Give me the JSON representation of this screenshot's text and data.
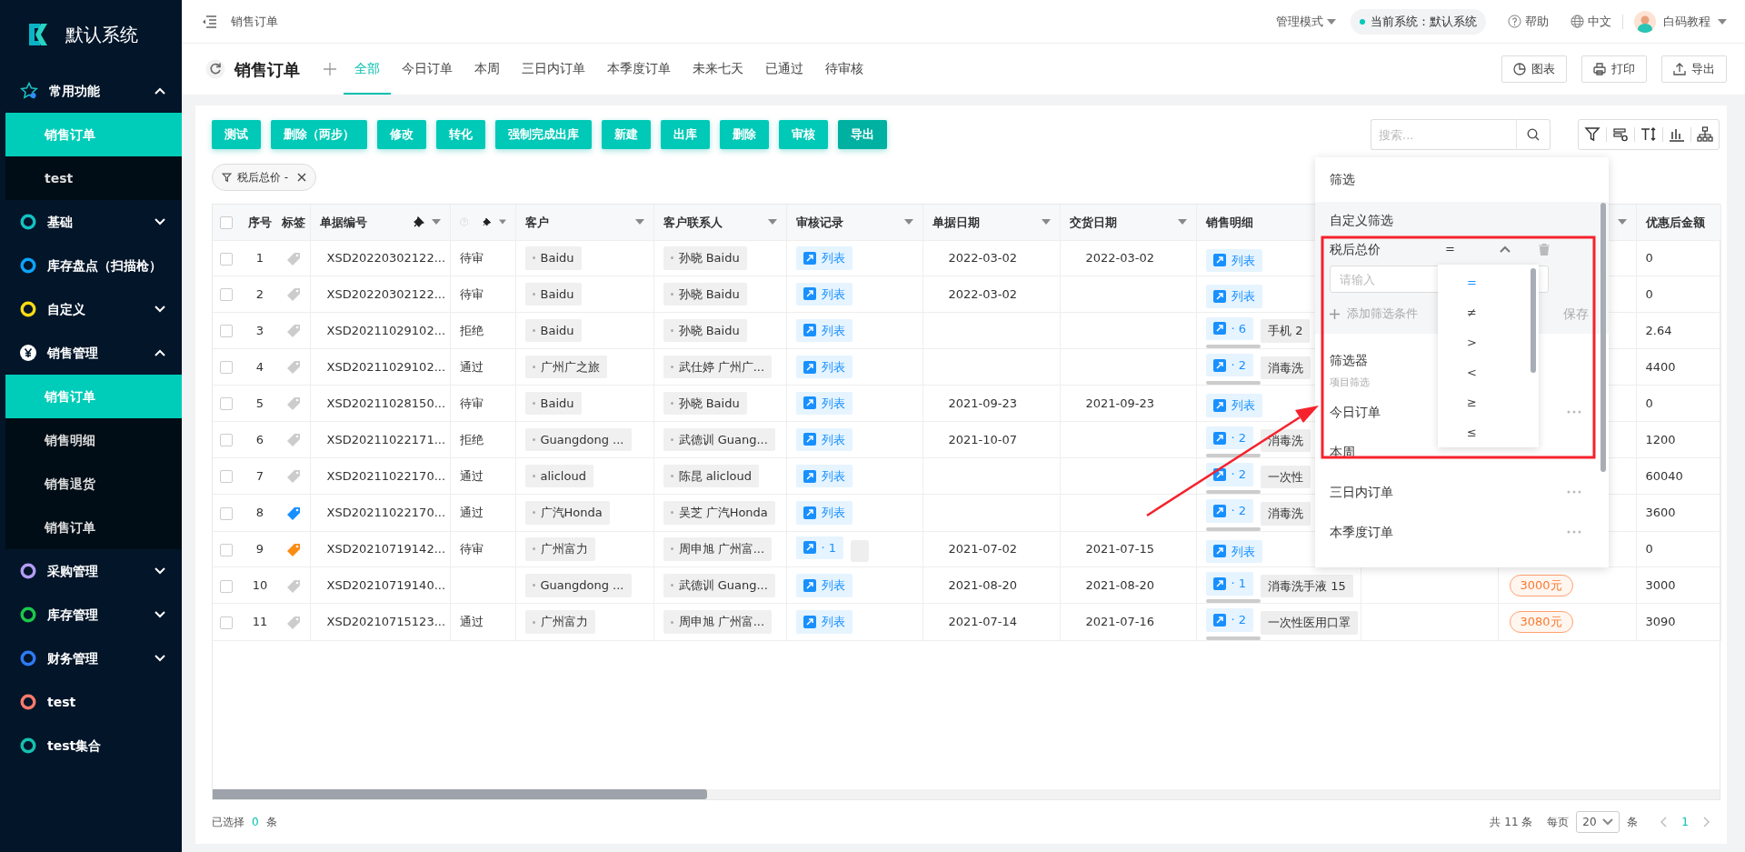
{
  "brand": {
    "name": "默认系统"
  },
  "sidebar": {
    "items": [
      {
        "label": "常用功能",
        "kind": "star",
        "expanded": true,
        "children": [
          {
            "label": "销售订单",
            "selected": true
          },
          {
            "label": "test",
            "selected": false
          }
        ]
      },
      {
        "label": "基础",
        "kind": "ring",
        "color": "#13c2c2",
        "expanded": false
      },
      {
        "label": "库存盘点（扫描枪）",
        "kind": "ring",
        "color": "#0aa5ff"
      },
      {
        "label": "自定义",
        "kind": "ring",
        "color": "#fadb14",
        "expanded": false
      },
      {
        "label": "销售管理",
        "kind": "yen",
        "expanded": true,
        "children": [
          {
            "label": "销售订单",
            "selected": true
          },
          {
            "label": "销售明细",
            "selected": false
          },
          {
            "label": "销售退货",
            "selected": false
          },
          {
            "label": "销售订单",
            "selected": false
          }
        ]
      },
      {
        "label": "采购管理",
        "kind": "ring",
        "color": "#b39cf5",
        "expanded": false
      },
      {
        "label": "库存管理",
        "kind": "ring",
        "color": "#1bc94a",
        "expanded": false
      },
      {
        "label": "财务管理",
        "kind": "ring",
        "color": "#2f7bf5",
        "expanded": false
      },
      {
        "label": "test",
        "kind": "ring",
        "color": "#ff7a6b"
      },
      {
        "label": "test集合",
        "kind": "ring",
        "color": "#13c2b0"
      }
    ]
  },
  "header": {
    "breadcrumb": "销售订单",
    "mode": "管理模式",
    "system": "当前系统：默认系统",
    "help": "帮助",
    "language": "中文",
    "user": "白码教程"
  },
  "page": {
    "title": "销售订单",
    "tabs": [
      {
        "label": "全部",
        "selected": true
      },
      {
        "label": "今日订单",
        "selected": false
      },
      {
        "label": "本周",
        "selected": false
      },
      {
        "label": "三日内订单",
        "selected": false
      },
      {
        "label": "本季度订单",
        "selected": false
      },
      {
        "label": "未来七天",
        "selected": false
      },
      {
        "label": "已通过",
        "selected": false
      },
      {
        "label": "待审核",
        "selected": false
      }
    ],
    "actions": [
      {
        "label": "图表",
        "kind": "chart"
      },
      {
        "label": "打印",
        "kind": "print"
      },
      {
        "label": "导出",
        "kind": "export"
      }
    ]
  },
  "toolbar": {
    "buttons": [
      {
        "label": "测试",
        "active": false
      },
      {
        "label": "删除（两步）",
        "active": false
      },
      {
        "label": "修改",
        "active": false
      },
      {
        "label": "转化",
        "active": false
      },
      {
        "label": "强制完成出库",
        "active": false
      },
      {
        "label": "新建",
        "active": false
      },
      {
        "label": "出库",
        "active": false
      },
      {
        "label": "删除",
        "active": false
      },
      {
        "label": "审核",
        "active": false
      },
      {
        "label": "导出",
        "active": true
      }
    ],
    "search": {
      "placeholder": "搜索..."
    },
    "filter_tags": [
      {
        "label": "税后总价 -"
      }
    ]
  },
  "table": {
    "select_all": {
      "selected": false
    },
    "columns": [
      {
        "label": "序号",
        "kind": "index"
      },
      {
        "label": "标签",
        "kind": "tag"
      },
      {
        "label": "单据编号",
        "kind": "code",
        "pinned": true,
        "sortable": true
      },
      {
        "kind": "status",
        "help": true,
        "pinned": true,
        "sortable": true
      },
      {
        "label": "客户",
        "kind": "customer",
        "sortable": true
      },
      {
        "label": "客户联系人",
        "kind": "contact",
        "sortable": true
      },
      {
        "label": "审核记录",
        "kind": "audit",
        "sortable": true
      },
      {
        "label": "单据日期",
        "kind": "order_date",
        "sortable": true
      },
      {
        "label": "交货日期",
        "kind": "delivery_date",
        "sortable": true
      },
      {
        "label": "销售明细",
        "kind": "detail"
      },
      {
        "kind": "badge",
        "sortable": true
      },
      {
        "label": "优惠后金额",
        "kind": "discounted"
      }
    ],
    "rows": [
      {
        "selected": false,
        "index": "1",
        "color": "#cccccc",
        "code": "XSD20220302122...",
        "status": "待审",
        "customer": "Baidu",
        "contact": "孙晓 Baidu",
        "audit": {
          "kind": "list",
          "label": "列表"
        },
        "order_date": "2022-03-02",
        "delivery_date": "2022-03-02",
        "detail": {
          "kind": "list",
          "label": "列表"
        },
        "discounted": "0"
      },
      {
        "selected": false,
        "index": "2",
        "color": "#cccccc",
        "code": "XSD20220302122...",
        "status": "待审",
        "customer": "Baidu",
        "contact": "孙晓 Baidu",
        "audit": {
          "kind": "list",
          "label": "列表"
        },
        "order_date": "2022-03-02",
        "detail": {
          "kind": "list",
          "label": "列表"
        },
        "discounted": "0"
      },
      {
        "selected": false,
        "index": "3",
        "color": "#cccccc",
        "code": "XSD20211029102...",
        "status": "拒绝",
        "customer": "Baidu",
        "contact": "孙晓 Baidu",
        "audit": {
          "kind": "list",
          "label": "列表"
        },
        "detail": {
          "kind": "count",
          "label": "· 6",
          "item": "手机 2"
        },
        "discounted": "2.64"
      },
      {
        "selected": false,
        "index": "4",
        "color": "#cccccc",
        "code": "XSD20211029102...",
        "status": "通过",
        "customer": "广州广之旅",
        "contact": "武仕婷 广州广...",
        "audit": {
          "kind": "list",
          "label": "列表"
        },
        "detail": {
          "kind": "count",
          "label": "· 2",
          "item": "消毒洗"
        },
        "discounted": "4400"
      },
      {
        "selected": false,
        "index": "5",
        "color": "#cccccc",
        "code": "XSD20211028150...",
        "status": "待审",
        "customer": "Baidu",
        "contact": "孙晓 Baidu",
        "audit": {
          "kind": "list",
          "label": "列表"
        },
        "order_date": "2021-09-23",
        "delivery_date": "2021-09-23",
        "detail": {
          "kind": "list",
          "label": "列表"
        },
        "discounted": "0"
      },
      {
        "selected": false,
        "index": "6",
        "color": "#cccccc",
        "code": "XSD20211022171...",
        "status": "拒绝",
        "customer": "Guangdong ...",
        "contact": "武德训 Guang...",
        "audit": {
          "kind": "list",
          "label": "列表"
        },
        "order_date": "2021-10-07",
        "detail": {
          "kind": "count",
          "label": "· 2",
          "item": "消毒洗"
        },
        "discounted": "1200"
      },
      {
        "selected": false,
        "index": "7",
        "color": "#cccccc",
        "code": "XSD20211022170...",
        "status": "通过",
        "customer": "alicloud",
        "contact": "陈昆 alicloud",
        "audit": {
          "kind": "list",
          "label": "列表"
        },
        "detail": {
          "kind": "count",
          "label": "· 2",
          "item": "一次性"
        },
        "discounted": "60040"
      },
      {
        "selected": false,
        "index": "8",
        "color": "#1890ff",
        "code": "XSD20211022170...",
        "status": "通过",
        "customer": "广汽Honda",
        "contact": "吴芝 广汽Honda",
        "audit": {
          "kind": "list",
          "label": "列表"
        },
        "detail": {
          "kind": "count",
          "label": "· 2",
          "item": "消毒洗"
        },
        "discounted": "3600"
      },
      {
        "selected": false,
        "index": "9",
        "color": "#fa8c16",
        "code": "XSD20210719142...",
        "status": "待审",
        "customer": "广州富力",
        "contact": "周申旭 广州富...",
        "audit": {
          "kind": "count",
          "label": "· 1"
        },
        "order_date": "2021-07-02",
        "delivery_date": "2021-07-15",
        "detail": {
          "kind": "list",
          "label": "列表"
        },
        "discounted": "0"
      },
      {
        "selected": false,
        "index": "10",
        "color": "#cccccc",
        "code": "XSD20210719140...",
        "customer": "Guangdong ...",
        "contact": "武德训 Guang...",
        "audit": {
          "kind": "list",
          "label": "列表"
        },
        "order_date": "2021-08-20",
        "delivery_date": "2021-08-20",
        "detail": {
          "kind": "count",
          "label": "· 1",
          "item": "消毒洗手液 15"
        },
        "badge": "3000元",
        "discounted": "3000"
      },
      {
        "selected": false,
        "index": "11",
        "color": "#cccccc",
        "code": "XSD20210715123...",
        "status": "通过",
        "customer": "广州富力",
        "contact": "周申旭 广州富...",
        "audit": {
          "kind": "list",
          "label": "列表"
        },
        "order_date": "2021-07-14",
        "delivery_date": "2021-07-16",
        "detail": {
          "kind": "count",
          "label": "· 2",
          "item": "一次性医用口罩"
        },
        "badge": "3080元",
        "discounted": "3090"
      }
    ]
  },
  "footer": {
    "selected_label": "已选择",
    "selected_count": "0",
    "selected_unit": "条",
    "total": "共 11 条",
    "per_page_label": "每页",
    "per_page": "20",
    "per_page_unit": "条",
    "page": "1"
  },
  "filter_panel": {
    "title": "筛选",
    "custom_title": "自定义筛选",
    "condition": {
      "field": "税后总价",
      "operator": "=",
      "placeholder": "请输入"
    },
    "add_label": "添加筛选条件",
    "save_label": "保存",
    "operators": [
      {
        "label": "=",
        "selected": true
      },
      {
        "label": "≠",
        "selected": false
      },
      {
        "label": ">",
        "selected": false
      },
      {
        "label": "<",
        "selected": false
      },
      {
        "label": "≥",
        "selected": false
      },
      {
        "label": "≤",
        "selected": false
      }
    ],
    "filters_title": "筛选器",
    "group_label": "项目筛选",
    "filters": [
      {
        "label": "今日订单",
        "more": true
      },
      {
        "label": "本周",
        "more": false
      },
      {
        "label": "三日内订单",
        "more": true
      },
      {
        "label": "本季度订单",
        "more": true
      }
    ]
  }
}
